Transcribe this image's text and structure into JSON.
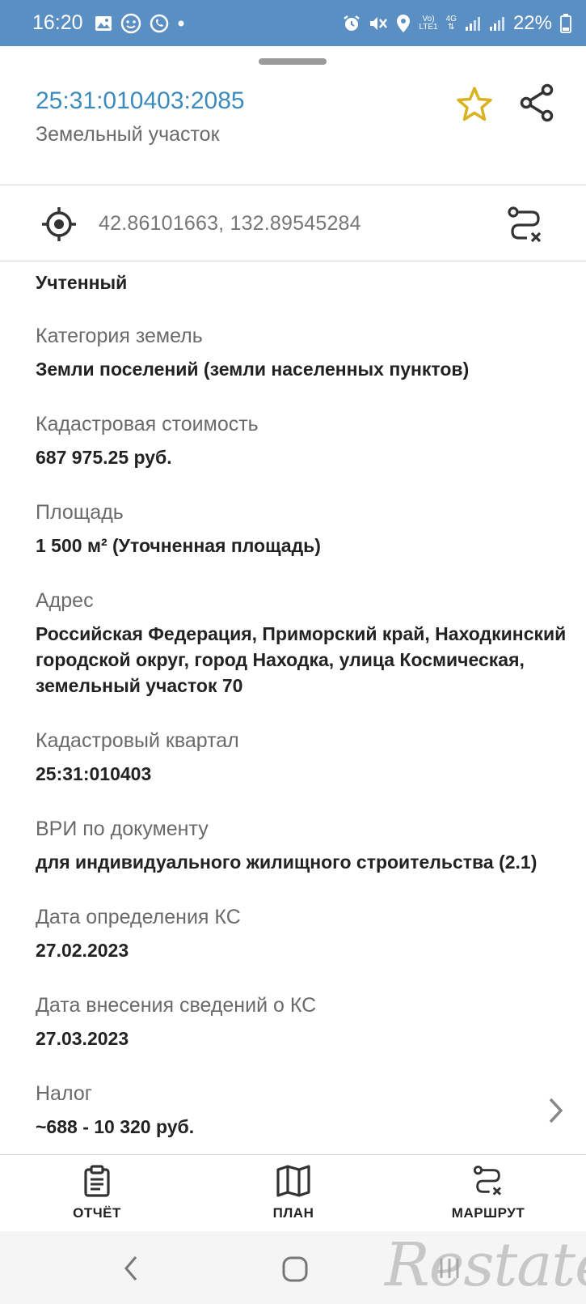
{
  "status_bar": {
    "time": "16:20",
    "battery": "22%",
    "network_label_top": "Vo)",
    "network_label_bottom": "LTE1",
    "network_type": "4G",
    "icons_left": [
      "image-icon",
      "face-icon",
      "whatsapp-icon",
      "dot-icon"
    ],
    "icons_right": [
      "alarm-icon",
      "mute-icon",
      "location-icon",
      "signal-icon",
      "signal-icon",
      "battery-icon"
    ]
  },
  "header": {
    "cadastral_number": "25:31:010403:2085",
    "object_type": "Земельный участок",
    "star_color": "#d8b21f",
    "accent_color": "#3c8bbd"
  },
  "coords": {
    "value": "42.86101663, 132.89545284"
  },
  "status": "Учтенный",
  "fields": [
    {
      "label": "Категория земель",
      "value": "Земли поселений (земли населенных пунктов)"
    },
    {
      "label": "Кадастровая стоимость",
      "value": "687 975.25 руб."
    },
    {
      "label": "Площадь",
      "value": "1 500 м² (Уточненная площадь)"
    },
    {
      "label": "Адрес",
      "value": "Российская Федерация, Приморский край, Находкинский городской округ, город Находка, улица Космическая, земельный участок 70"
    },
    {
      "label": "Кадастровый квартал",
      "value": "25:31:010403"
    },
    {
      "label": "ВРИ по документу",
      "value": "для индивидуального жилищного строительства (2.1)"
    },
    {
      "label": "Дата определения КС",
      "value": "27.02.2023"
    },
    {
      "label": "Дата внесения сведений о КС",
      "value": "27.03.2023"
    },
    {
      "label": "Налог",
      "value": "~688 - 10 320 руб."
    }
  ],
  "bottom_nav": {
    "report": "ОТЧЁТ",
    "plan": "ПЛАН",
    "route": "МАРШРУТ"
  },
  "watermark": "Restate"
}
